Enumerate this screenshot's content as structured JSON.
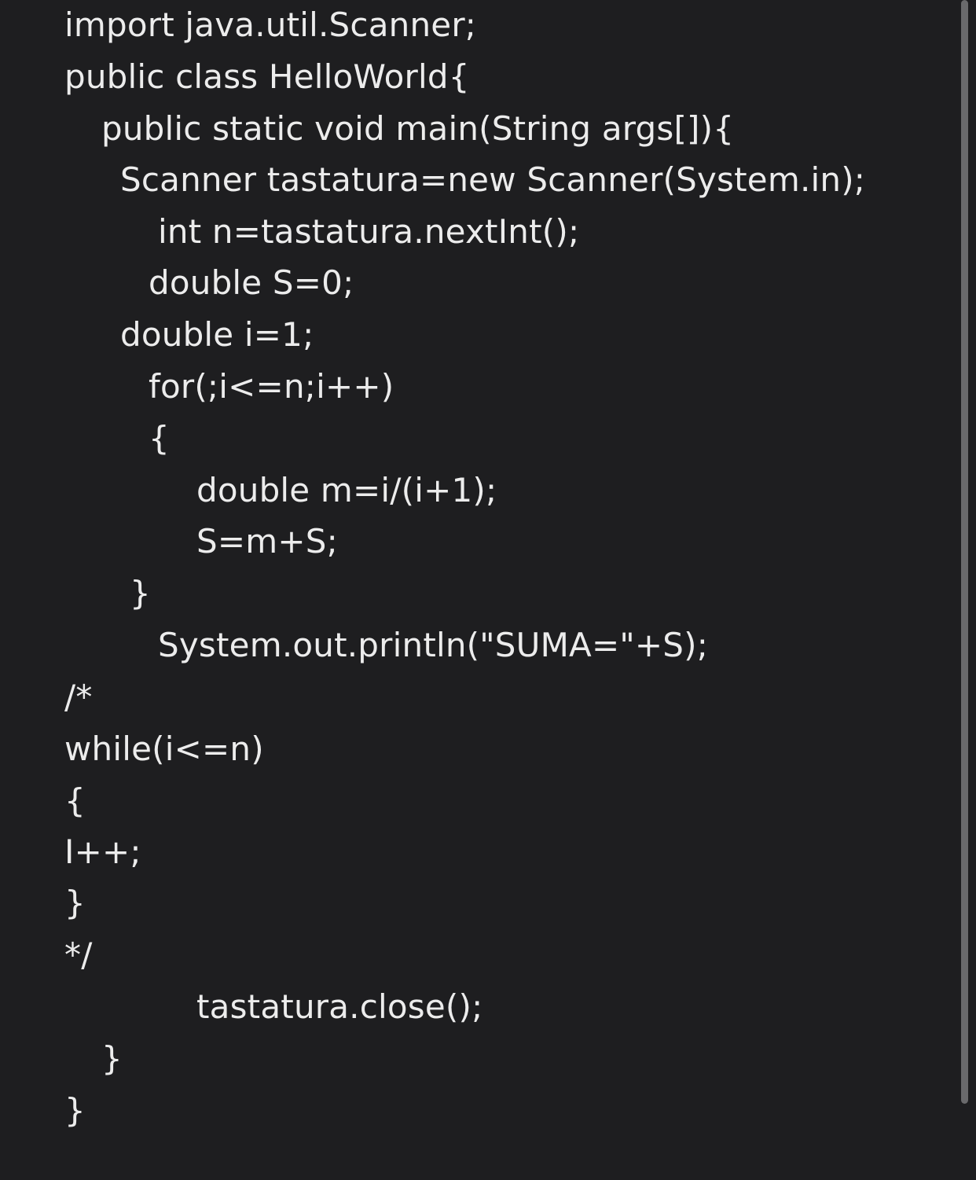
{
  "editor": {
    "lines": [
      "import java.util.Scanner;",
      "public class HelloWorld{",
      "public static void main(String args[]){",
      "Scanner tastatura=new Scanner(System.in);",
      "int n=tastatura.nextInt();",
      "double S=0;",
      "double i=1;",
      "for(;i<=n;i++)",
      "{",
      "double m=i/(i+1);",
      "S=m+S;",
      "}",
      "System.out.println(\"SUMA=\"+S);",
      "/*",
      "while(i<=n)",
      "{",
      "I++;",
      "}",
      "*/",
      "tastatura.close();",
      "}",
      "}"
    ]
  },
  "colors": {
    "background": "#1e1e20",
    "text": "#ececec",
    "scrollbar": "#6a6a6c"
  }
}
